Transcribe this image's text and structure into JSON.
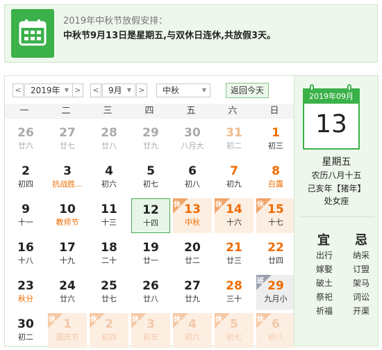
{
  "banner": {
    "title": "2019年中秋节放假安排：",
    "text": "中秋节9月13日是星期五,与双休日连休,共放假3天。",
    "icon": "calendar-icon"
  },
  "toolbar": {
    "prev_year": "<",
    "year": "2019年",
    "next_year": ">",
    "prev_month": "<",
    "month": "9月",
    "next_month": ">",
    "holiday": "中秋",
    "today": "返回今天"
  },
  "weekdays": [
    "一",
    "二",
    "三",
    "四",
    "五",
    "六",
    "日"
  ],
  "weeks": [
    [
      {
        "day": "26",
        "lunar": "廿六",
        "other": true
      },
      {
        "day": "27",
        "lunar": "廿七",
        "other": true
      },
      {
        "day": "28",
        "lunar": "廿八",
        "other": true
      },
      {
        "day": "29",
        "lunar": "廿九",
        "other": true
      },
      {
        "day": "30",
        "lunar": "八月大",
        "other": true
      },
      {
        "day": "31",
        "lunar": "初二",
        "other": true,
        "weekend": true
      },
      {
        "day": "1",
        "lunar": "初三",
        "weekend": true
      }
    ],
    [
      {
        "day": "2",
        "lunar": "初四"
      },
      {
        "day": "3",
        "lunar": "抗战胜...",
        "festival": true
      },
      {
        "day": "4",
        "lunar": "初六"
      },
      {
        "day": "5",
        "lunar": "初七"
      },
      {
        "day": "6",
        "lunar": "初八"
      },
      {
        "day": "7",
        "lunar": "初九",
        "weekend": true
      },
      {
        "day": "8",
        "lunar": "白露",
        "weekend": true,
        "festival": true
      }
    ],
    [
      {
        "day": "9",
        "lunar": "十一"
      },
      {
        "day": "10",
        "lunar": "教师节",
        "festival": true
      },
      {
        "day": "11",
        "lunar": "十三"
      },
      {
        "day": "12",
        "lunar": "十四",
        "selected": true
      },
      {
        "day": "13",
        "lunar": "中秋",
        "holiday": true,
        "tag": "休",
        "festival": true
      },
      {
        "day": "14",
        "lunar": "十六",
        "holiday": true,
        "tag": "休"
      },
      {
        "day": "15",
        "lunar": "十七",
        "holiday": true,
        "tag": "休"
      }
    ],
    [
      {
        "day": "16",
        "lunar": "十八"
      },
      {
        "day": "17",
        "lunar": "十九"
      },
      {
        "day": "18",
        "lunar": "二十"
      },
      {
        "day": "19",
        "lunar": "廿一"
      },
      {
        "day": "20",
        "lunar": "廿二"
      },
      {
        "day": "21",
        "lunar": "廿三",
        "weekend": true
      },
      {
        "day": "22",
        "lunar": "廿四",
        "weekend": true
      }
    ],
    [
      {
        "day": "23",
        "lunar": "秋分",
        "festival": true
      },
      {
        "day": "24",
        "lunar": "廿六"
      },
      {
        "day": "25",
        "lunar": "廿七"
      },
      {
        "day": "26",
        "lunar": "廿八"
      },
      {
        "day": "27",
        "lunar": "廿九"
      },
      {
        "day": "28",
        "lunar": "三十",
        "weekend": true
      },
      {
        "day": "29",
        "lunar": "九月小",
        "weekend": true,
        "work": true,
        "tag": "班"
      }
    ],
    [
      {
        "day": "30",
        "lunar": "初二"
      },
      {
        "day": "1",
        "lunar": "国庆节",
        "other": true,
        "holiday": true,
        "tag": "休"
      },
      {
        "day": "2",
        "lunar": "初四",
        "other": true,
        "holiday": true,
        "tag": "休"
      },
      {
        "day": "3",
        "lunar": "初五",
        "other": true,
        "holiday": true,
        "tag": "休"
      },
      {
        "day": "4",
        "lunar": "初六",
        "other": true,
        "holiday": true,
        "tag": "休"
      },
      {
        "day": "5",
        "lunar": "初七",
        "other": true,
        "holiday": true,
        "tag": "休"
      },
      {
        "day": "6",
        "lunar": "初八",
        "other": true,
        "holiday": true,
        "tag": "休"
      }
    ]
  ],
  "side": {
    "header": "2019年09月",
    "day": "13",
    "weekday": "星期五",
    "lunar": "农历八月十五",
    "ganzhi": "己亥年【猪年】",
    "zodiac": "处女座",
    "yi_label": "宜",
    "ji_label": "忌",
    "yi": [
      "出行",
      "嫁娶",
      "破土",
      "祭祀",
      "祈福"
    ],
    "ji": [
      "纳采",
      "订盟",
      "架马",
      "词讼",
      "开渠"
    ]
  },
  "colors": {
    "accent_green": "#3bb14a",
    "orange": "#ef6c00",
    "holiday_bg": "#fdeee2"
  }
}
